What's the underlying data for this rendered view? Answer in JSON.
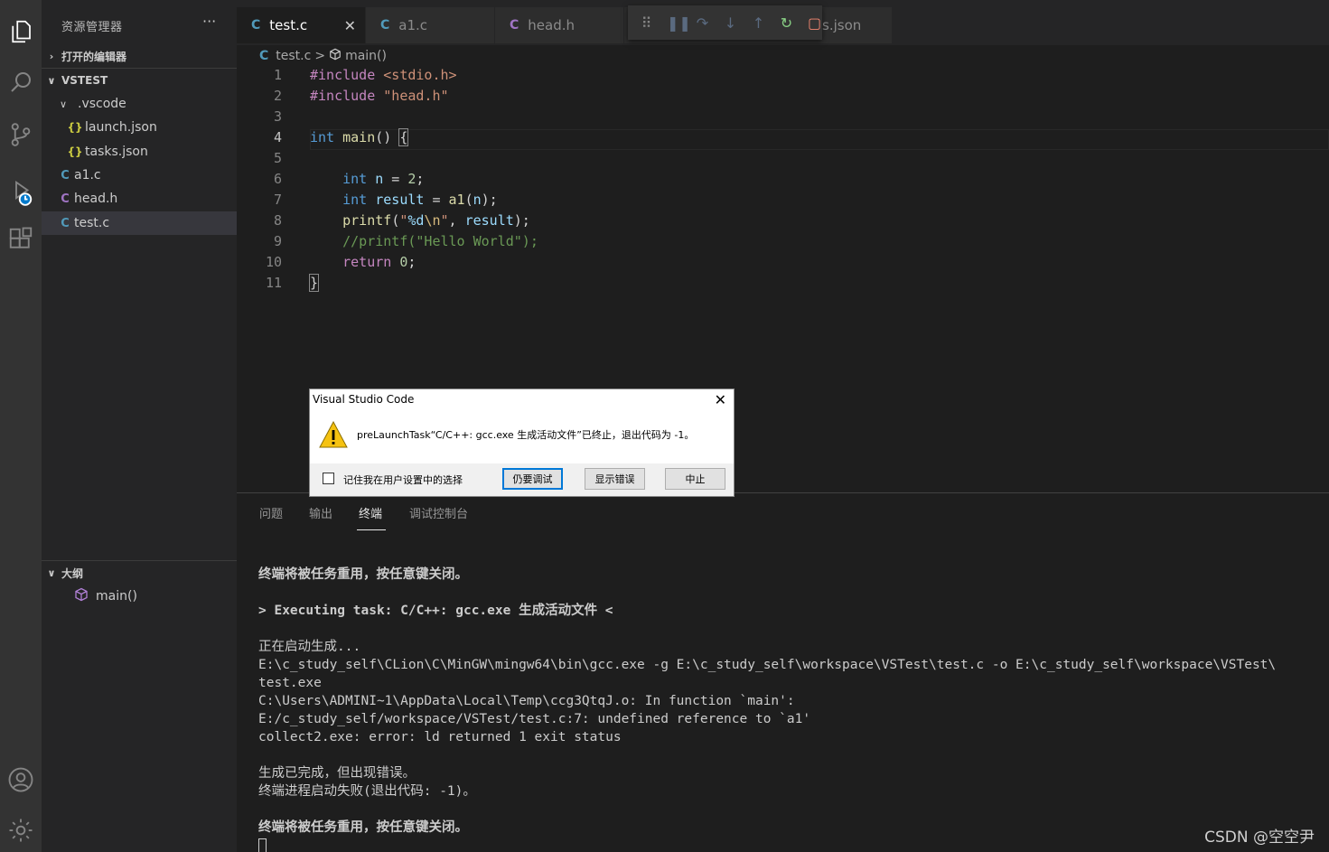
{
  "sidebar": {
    "title": "资源管理器",
    "more": "···",
    "open_editors": "打开的编辑器",
    "workspace": "VSTEST",
    "items": [
      {
        "label": ".vscode",
        "icon": "folder-open",
        "chevron": "∨"
      },
      {
        "label": "launch.json",
        "icon": "{}"
      },
      {
        "label": "tasks.json",
        "icon": "{}"
      },
      {
        "label": "a1.c",
        "icon": "C"
      },
      {
        "label": "head.h",
        "icon": "C"
      },
      {
        "label": "test.c",
        "icon": "C"
      }
    ],
    "outline": "大纲",
    "outline_item": "main()"
  },
  "tabs": [
    {
      "label": "test.c",
      "icon": "C",
      "close": "✕"
    },
    {
      "label": "a1.c",
      "icon": "C"
    },
    {
      "label": "head.h",
      "icon": "C"
    },
    {
      "label": "s.json"
    }
  ],
  "breadcrumb": {
    "file_icon": "C",
    "file": "test.c",
    "sep": ">",
    "symbol": "main()"
  },
  "code_lines": [
    "1",
    "2",
    "3",
    "4",
    "5",
    "6",
    "7",
    "8",
    "9",
    "10",
    "11"
  ],
  "code": {
    "l1_pp": "#include",
    "l1_inc": "<stdio.h>",
    "l2_pp": "#include",
    "l2_inc": "\"head.h\"",
    "l4_kw": "int",
    "l4_fn": "main",
    "l4_rest": "() ",
    "l4_brace": "{",
    "l6_kw": "int",
    "l6_var": "n",
    "l6_eq": " = ",
    "l6_num": "2",
    "l6_end": ";",
    "l7_kw": "int",
    "l7_var": "result",
    "l7_eq": " = ",
    "l7_fn": "a1",
    "l7_p1": "(",
    "l7_arg": "n",
    "l7_p2": ");",
    "l8_fn": "printf",
    "l8_p1": "(",
    "l8_s1": "\"",
    "l8_fmt": "%d",
    "l8_esc": "\\n",
    "l8_s2": "\"",
    "l8_comma": ", ",
    "l8_var": "result",
    "l8_end": ");",
    "l9_cmt": "//printf(\"Hello World\");",
    "l10_kw": "return",
    "l10_num": "0",
    "l10_end": ";",
    "l11_brace": "}"
  },
  "dialog": {
    "title": "Visual Studio Code",
    "close": "✕",
    "message": "preLaunchTask“C/C++: gcc.exe 生成活动文件”已终止，退出代码为 -1。",
    "checkbox": "记住我在用户设置中的选择",
    "btn_debug": "仍要调试",
    "btn_show": "显示错误",
    "btn_abort": "中止"
  },
  "panel": {
    "tabs": [
      "问题",
      "输出",
      "终端",
      "调试控制台"
    ],
    "terminal": [
      {
        "text": "终端将被任务重用，按任意键关闭。",
        "bold": true
      },
      {
        "text": "",
        "bold": false
      },
      {
        "text": "> Executing task: C/C++: gcc.exe 生成活动文件 <",
        "bold": true
      },
      {
        "text": "",
        "bold": false
      },
      {
        "text": "正在启动生成...",
        "bold": false
      },
      {
        "text": "E:\\c_study_self\\CLion\\C\\MinGW\\mingw64\\bin\\gcc.exe -g E:\\c_study_self\\workspace\\VSTest\\test.c -o E:\\c_study_self\\workspace\\VSTest\\",
        "bold": false
      },
      {
        "text": "test.exe",
        "bold": false
      },
      {
        "text": "C:\\Users\\ADMINI~1\\AppData\\Local\\Temp\\ccg3QtqJ.o: In function `main':",
        "bold": false
      },
      {
        "text": "E:/c_study_self/workspace/VSTest/test.c:7: undefined reference to `a1'",
        "bold": false
      },
      {
        "text": "collect2.exe: error: ld returned 1 exit status",
        "bold": false
      },
      {
        "text": "",
        "bold": false
      },
      {
        "text": "生成已完成，但出现错误。",
        "bold": false
      },
      {
        "text": "终端进程启动失败(退出代码: -1)。",
        "bold": false
      },
      {
        "text": "",
        "bold": false
      },
      {
        "text": "终端将被任务重用，按任意键关闭。",
        "bold": true
      }
    ]
  },
  "watermark": "CSDN @空空尹",
  "colors": {
    "accent": "#007acc",
    "warning": "#f5c211",
    "debug_restart": "#89d185",
    "debug_stop": "#f48771"
  }
}
